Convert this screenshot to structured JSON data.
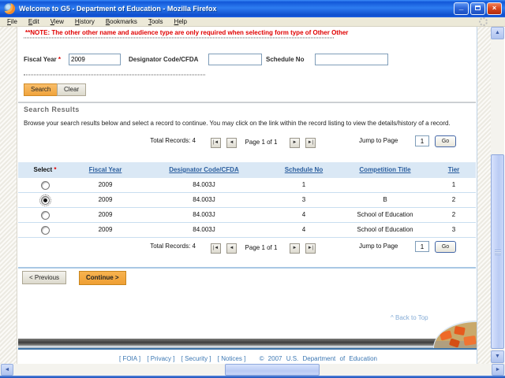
{
  "window": {
    "title": "Welcome to G5 - Department of Education - Mozilla Firefox",
    "menu": [
      "File",
      "Edit",
      "View",
      "History",
      "Bookmarks",
      "Tools",
      "Help"
    ]
  },
  "icons": {
    "minimize": "_",
    "close": "×",
    "first": "|◄",
    "prev": "◄",
    "next": "►",
    "last": "►|",
    "up": "▲",
    "down": "▼",
    "left": "◄",
    "right": "►"
  },
  "note": "**NOTE: The other other name and audience type are only required when selecting form type of Other Other",
  "form": {
    "fiscal_year": {
      "label": "Fiscal Year",
      "required": "*",
      "value": "2009"
    },
    "designator": {
      "label": "Designator Code/CFDA",
      "value": ""
    },
    "schedule": {
      "label": "Schedule No",
      "value": ""
    },
    "search_label": "Search",
    "clear_label": "Clear"
  },
  "results": {
    "heading": "Search Results",
    "instructions": "Browse your search results below and select a record to continue. You may click on the link within the record listing to view the details/history of a record.",
    "pagination": {
      "total_label": "Total Records: 4",
      "page_label": "Page 1 of 1",
      "jump_label": "Jump to Page",
      "jump_value": "1",
      "go_label": "Go"
    },
    "table": {
      "select_header": "Select",
      "select_required": "*",
      "headers": [
        "Fiscal Year",
        "Designator Code/CFDA",
        "Schedule No",
        "Competition Title",
        "Tier"
      ],
      "rows": [
        {
          "fiscal_year": "2009",
          "designator": "84.003J",
          "schedule_no": "1",
          "competition_title": "",
          "tier": "1",
          "selected": false
        },
        {
          "fiscal_year": "2009",
          "designator": "84.003J",
          "schedule_no": "3",
          "competition_title": "B",
          "tier": "2",
          "selected": true
        },
        {
          "fiscal_year": "2009",
          "designator": "84.003J",
          "schedule_no": "4",
          "competition_title": "School of Education",
          "tier": "2",
          "selected": false
        },
        {
          "fiscal_year": "2009",
          "designator": "84.003J",
          "schedule_no": "4",
          "competition_title": "School of Education",
          "tier": "3",
          "selected": false
        }
      ]
    },
    "previous_label": "< Previous",
    "continue_label": "Continue >"
  },
  "footer": {
    "back_to_top": "^ Back to Top",
    "links": [
      "[ FOIA ]",
      "[ Privacy ]",
      "[ Security ]",
      "[ Notices ]"
    ],
    "copyright": "© 2007 U.S. Department of Education"
  },
  "colors": {
    "titlebar_blue": "#1A5CDB",
    "note_red": "#E00000",
    "link_blue": "#2B5E9E",
    "button_orange": "#F2A843",
    "table_header_bg": "#DAE8F5",
    "footer_text_blue": "#3B77B3"
  }
}
